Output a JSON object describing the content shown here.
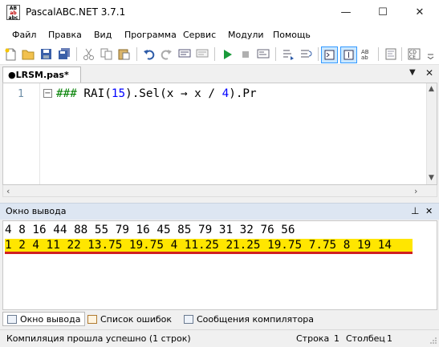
{
  "window": {
    "title": "PascalABC.NET 3.7.1",
    "controls": {
      "minimize": "—",
      "maximize": "☐",
      "close": "✕"
    }
  },
  "menu": [
    "Файл",
    "Правка",
    "Вид",
    "Программа",
    "Сервис",
    "Модули",
    "Помощь"
  ],
  "toolbar_icons": [
    "new-file-icon",
    "open-folder-icon",
    "save-icon",
    "save-all-icon",
    "cut-icon",
    "copy-icon",
    "paste-icon",
    "undo-icon",
    "redo-icon",
    "comment-icon",
    "uncomment-icon",
    "run-icon",
    "stop-icon",
    "debug-icon",
    "step-icon",
    "console-icon",
    "output-icon",
    "intellisense-icon",
    "format-icon",
    "code-icon"
  ],
  "editor": {
    "tab_label": "●LRSM.pas*",
    "line_number": "1",
    "code": {
      "hashes": "###",
      "before_num": " RAI(",
      "num1": "15",
      "middle": ").Sel(x → x / ",
      "num2": "4",
      "after": ").Pr"
    }
  },
  "output": {
    "title": "Окно вывода",
    "pin": "⊥",
    "close": "✕",
    "lines": [
      "4 8 16 44 88 55 79 16 45 85 79 31 32 76 56",
      "1 2 4 11 22 13.75 19.75 4 11.25 21.25 19.75 7.75 8 19 14"
    ]
  },
  "bottom_tabs": [
    "Окно вывода",
    "Список ошибок",
    "Сообщения компилятора"
  ],
  "status": {
    "message": "Компиляция прошла успешно (1 строк)",
    "row_label": "Строка",
    "row_value": "1",
    "col_label": "Столбец",
    "col_value": "1"
  },
  "colors": {
    "highlight": "#ffe600",
    "highlight_underline": "#d02020",
    "comment_green": "#008000",
    "number_blue": "#0000ff",
    "panel_header": "#dde6f2"
  }
}
